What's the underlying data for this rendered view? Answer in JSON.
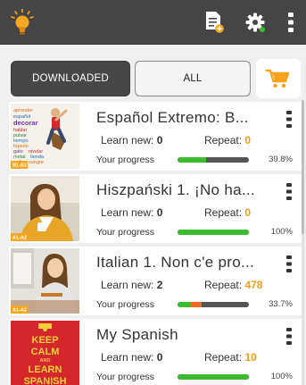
{
  "tabs": {
    "downloaded": "DOWNLOADED",
    "all": "ALL"
  },
  "courses": [
    {
      "title": "Español Extremo: B...",
      "learn_label": "Learn new:",
      "learn_value": "0",
      "repeat_label": "Repeat:",
      "repeat_value": "0",
      "progress_label": "Your progress",
      "progress_text": "39.8%",
      "progress": 0.398,
      "level_badge": "B1-B2",
      "thumb_words": [
        "aprender",
        "español",
        "decorar",
        "hablar",
        "pulsar",
        "tiempo",
        "bípedo",
        "gato",
        "nivelar",
        "metal",
        "tienda",
        "cubo",
        "sangre"
      ]
    },
    {
      "title": "Hiszpański 1. ¡No ha...",
      "learn_label": "Learn new:",
      "learn_value": "0",
      "repeat_label": "Repeat:",
      "repeat_value": "0",
      "progress_label": "Your progress",
      "progress_text": "100%",
      "progress": 1.0,
      "level_badge": "A1-A2"
    },
    {
      "title": "Italian 1. Non c'e pro...",
      "learn_label": "Learn new:",
      "learn_value": "2",
      "repeat_label": "Repeat:",
      "repeat_value": "478",
      "progress_label": "Your progress",
      "progress_text": "33.7%",
      "progress": 0.337,
      "level_badge": "A1-A2"
    },
    {
      "title": "My Spanish",
      "learn_label": "Learn new:",
      "learn_value": "0",
      "repeat_label": "Repeat:",
      "repeat_value": "10",
      "progress_label": "Your progress",
      "progress_text": "100%",
      "progress": 1.0,
      "thumb_text": [
        "KEEP",
        "CALM",
        "AND",
        "LEARN",
        "SPANISH"
      ]
    }
  ],
  "colors": {
    "topbar": "#454545",
    "accent_orange": "#f59a16",
    "progress_green": "#3dbb2e",
    "progress_red": "#ef6b22",
    "cart_orange": "#f7a21a"
  },
  "icons": {
    "logo": "lightbulb-head-icon",
    "new_course": "add-document-icon",
    "settings": "gear-icon",
    "menu": "vertical-dots-icon",
    "cart": "shopping-cart-icon"
  }
}
